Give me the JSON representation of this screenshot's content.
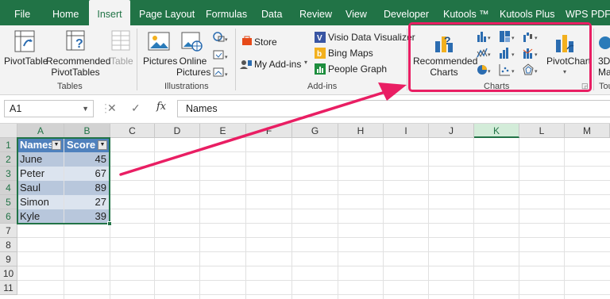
{
  "tabs": [
    "File",
    "Home",
    "Insert",
    "Page Layout",
    "Formulas",
    "Data",
    "Review",
    "View",
    "Developer",
    "Kutools ™",
    "Kutools Plus",
    "WPS PDF"
  ],
  "ribbon": {
    "tables": {
      "pivottable": "PivotTable",
      "recommended_pivottables_1": "Recommended",
      "recommended_pivottables_2": "PivotTables",
      "table": "Table",
      "group_label": "Tables"
    },
    "illustrations": {
      "pictures": "Pictures",
      "online_pictures_1": "Online",
      "online_pictures_2": "Pictures",
      "group_label": "Illustrations"
    },
    "addins": {
      "store": "Store",
      "my_addins": "My Add-ins",
      "visio": "Visio Data Visualizer",
      "bing_maps": "Bing Maps",
      "people_graph": "People Graph",
      "group_label": "Add-ins"
    },
    "charts": {
      "recommended_charts_1": "Recommended",
      "recommended_charts_2": "Charts",
      "pivotchart": "PivotChart",
      "group_label": "Charts"
    },
    "tours": {
      "label_1": "3D",
      "label_2": "Ma",
      "group_label": "Tou"
    }
  },
  "formula_bar": {
    "name_box": "A1",
    "cancel": "✕",
    "enter": "✓",
    "fx": "fx",
    "value": "Names"
  },
  "columns": [
    "A",
    "B",
    "C",
    "D",
    "E",
    "F",
    "G",
    "H",
    "I",
    "J",
    "K",
    "L",
    "M"
  ],
  "rows": [
    "1",
    "2",
    "3",
    "4",
    "5",
    "6",
    "7",
    "8",
    "9",
    "10",
    "11"
  ],
  "table": {
    "headers": [
      "Names",
      "Score"
    ],
    "rows": [
      {
        "name": "June",
        "score": "45"
      },
      {
        "name": "Peter",
        "score": "67"
      },
      {
        "name": "Saul",
        "score": "89"
      },
      {
        "name": "Simon",
        "score": "27"
      },
      {
        "name": "Kyle",
        "score": "39"
      }
    ]
  },
  "colors": {
    "excel_green": "#217346",
    "table_header": "#4f81bd",
    "table_band": "#b8c7dc",
    "highlight": "#e91e63"
  },
  "icons": [
    "pivottable-icon",
    "recommended-pivottables-icon",
    "table-icon",
    "pictures-icon",
    "online-pictures-icon",
    "shapes-icon",
    "store-icon",
    "my-addins-icon",
    "visio-icon",
    "bing-maps-icon",
    "people-graph-icon",
    "recommended-charts-icon",
    "column-chart-icon",
    "hierarchy-chart-icon",
    "waterfall-chart-icon",
    "line-chart-icon",
    "statistic-chart-icon",
    "combo-chart-icon",
    "pie-chart-icon",
    "scatter-chart-icon",
    "radar-chart-icon",
    "pivotchart-icon",
    "dialog-launcher-icon",
    "filter-dropdown-icon"
  ]
}
